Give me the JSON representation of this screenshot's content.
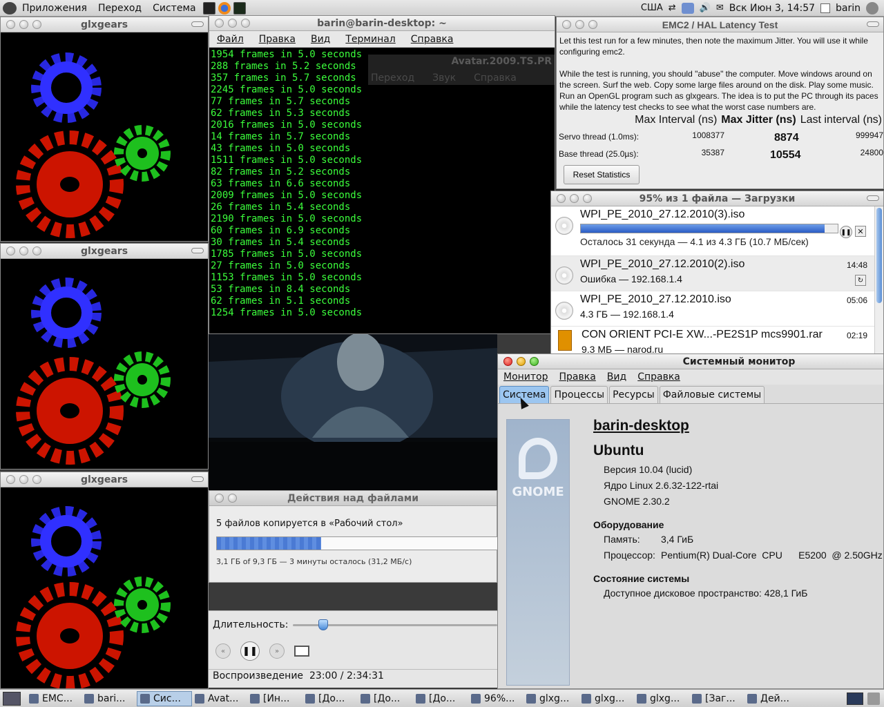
{
  "top_panel": {
    "menus": [
      "Приложения",
      "Переход",
      "Система"
    ],
    "keyboard_layout": "США",
    "datetime": "Вск Июн  3, 14:57",
    "user": "barin"
  },
  "glxgears": {
    "title": "glxgears"
  },
  "terminal": {
    "title": "barin@barin-desktop: ~",
    "menus": [
      "Файл",
      "Правка",
      "Вид",
      "Терминал",
      "Справка"
    ],
    "lines": [
      "1954 frames in 5.0 seconds",
      "288 frames in 5.2 seconds",
      "357 frames in 5.7 seconds",
      "2245 frames in 5.0 seconds",
      "77 frames in 5.7 seconds",
      "62 frames in 5.3 seconds",
      "2016 frames in 5.0 seconds",
      "14 frames in 5.7 seconds",
      "43 frames in 5.0 seconds",
      "1511 frames in 5.0 seconds",
      "82 frames in 5.2 seconds",
      "63 frames in 6.6 seconds",
      "2009 frames in 5.0 seconds",
      "26 frames in 5.4 seconds",
      "2190 frames in 5.0 seconds",
      "60 frames in 6.9 seconds",
      "30 frames in 5.4 seconds",
      "1785 frames in 5.0 seconds",
      "27 frames in 5.0 seconds",
      "1153 frames in 5.0 seconds",
      "53 frames in 8.4 seconds",
      "62 frames in 5.1 seconds",
      "1254 frames in 5.0 seconds"
    ],
    "ghost_title": "Avatar.2009.TS.PR",
    "ghost_menus": [
      "Переход",
      "Звук",
      "Справка"
    ]
  },
  "emc": {
    "title": "EMC2 / HAL Latency Test",
    "para1": "Let this test run for a few minutes, then note the maximum Jitter.  You will use it while configuring emc2.",
    "para2": "While the test is running, you should \"abuse\" the computer. Move windows around on the screen. Surf the web. Copy some large files around on the disk. Play some music. Run an OpenGL program such as glxgears. The idea is to put the PC through its paces while the latency test checks to see what the worst case numbers are.",
    "col_max_interval": "Max Interval (ns)",
    "col_max_jitter": "Max Jitter (ns)",
    "col_last_interval": "Last interval (ns)",
    "rows": [
      {
        "label": "Servo thread (1.0ms):",
        "max_interval": "1008377",
        "max_jitter": "8874",
        "last_interval": "999947"
      },
      {
        "label": "Base thread (25.0µs):",
        "max_interval": "35387",
        "max_jitter": "10554",
        "last_interval": "24800"
      }
    ],
    "reset_label": "Reset Statistics"
  },
  "downloads": {
    "title": "95% из 1 файла — Загрузки",
    "items": [
      {
        "name": "WPI_PE_2010_27.12.2010(3).iso",
        "status": "Осталось 31 секунда — 4.1 из 4.3 ГБ (10.7 МБ/сек)",
        "time": "",
        "progress": 0.95
      },
      {
        "name": "WPI_PE_2010_27.12.2010(2).iso",
        "status": "Ошибка — 192.168.1.4",
        "time": "14:48"
      },
      {
        "name": "WPI_PE_2010_27.12.2010.iso",
        "status": "4.3 ГБ — 192.168.1.4",
        "time": "05:06"
      },
      {
        "name": "CON ORIENT PCI-E XW...-PE2S1P mcs9901.rar",
        "status": "9.3 МБ — narod.ru",
        "time": "02:19"
      }
    ]
  },
  "fileops": {
    "title": "Действия над файлами",
    "message": "5 файлов копируется в «Рабочий стол»",
    "details": "3,1 ГБ of 9,3 ГБ — 3 минуты осталось (31,2 МБ/с)",
    "progress": 0.37
  },
  "player": {
    "duration_label": "Длительность:",
    "status_label": "Воспроизведение",
    "time": "23:00 / 2:34:31",
    "position": 0.149
  },
  "sysmon": {
    "title": "Системный монитор",
    "menus": [
      "Монитор",
      "Правка",
      "Вид",
      "Справка"
    ],
    "tabs": [
      "Система",
      "Процессы",
      "Ресурсы",
      "Файловые системы"
    ],
    "hostname": "barin-desktop",
    "distro": "Ubuntu",
    "version": "Версия 10.04 (lucid)",
    "kernel": "Ядро Linux 2.6.32-122-rtai",
    "gnome": "GNOME 2.30.2",
    "hw_title": "Оборудование",
    "mem_label": "Память:",
    "mem_value": "3,4 ГиБ",
    "cpu_label": "Процессор:",
    "cpu_value": "Pentium(R) Dual-Core  CPU      E5200  @ 2.50GHz",
    "status_title": "Состояние системы",
    "disk_label": "Доступное дисковое пространство:",
    "disk_value": "428,1 ГиБ",
    "gnome_logo": "GNOME"
  },
  "taskbar": {
    "tasks": [
      "EMC...",
      "bari...",
      "Сис...",
      "Avat...",
      "[Ин...",
      "[До...",
      "[До...",
      "[До...",
      "96%...",
      "glxg...",
      "glxg...",
      "glxg...",
      "[Заг...",
      "Дей..."
    ]
  }
}
